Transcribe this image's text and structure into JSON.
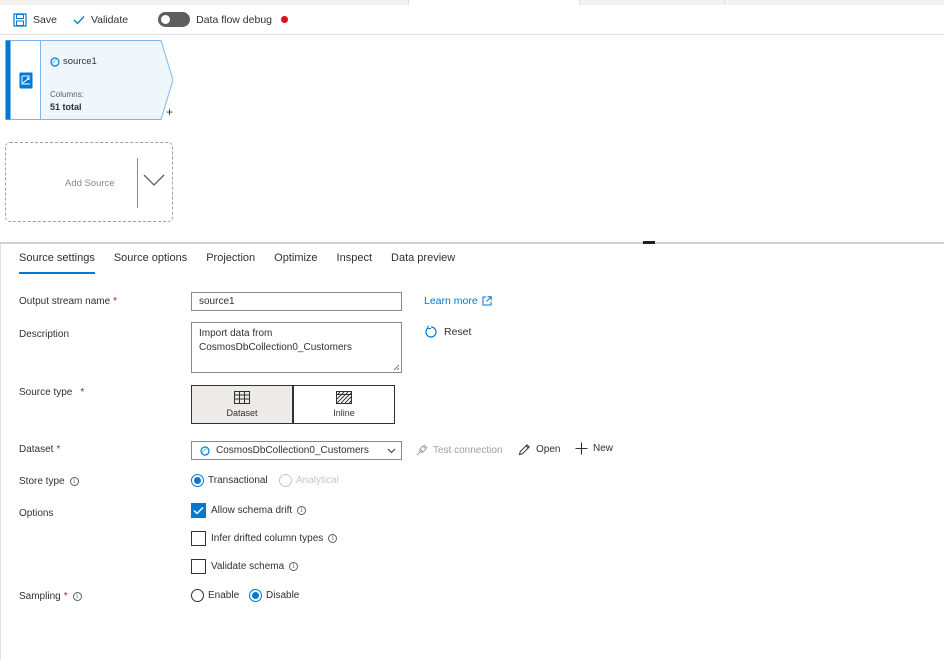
{
  "toolbar": {
    "save_label": "Save",
    "validate_label": "Validate",
    "debug_label": "Data flow debug",
    "debug_on": false
  },
  "canvas": {
    "node": {
      "name": "source1",
      "columns_label": "Columns:",
      "columns_value": "51 total",
      "plus": "+"
    },
    "add_source_label": "Add Source"
  },
  "tabs": [
    "Source settings",
    "Source options",
    "Projection",
    "Optimize",
    "Inspect",
    "Data preview"
  ],
  "active_tab": "Source settings",
  "form": {
    "output_stream": {
      "label": "Output stream name",
      "required": "*",
      "value": "source1",
      "learn_more": "Learn more"
    },
    "description": {
      "label": "Description",
      "line1": "Import data from",
      "line2": "CosmosDbCollection0_Customers",
      "reset": "Reset"
    },
    "source_type": {
      "label": "Source type",
      "required": "*",
      "options": [
        "Dataset",
        "Inline"
      ],
      "selected": "Dataset"
    },
    "dataset": {
      "label": "Dataset",
      "required": "*",
      "value": "CosmosDbCollection0_Customers",
      "test_connection": "Test connection",
      "open": "Open",
      "new": "New"
    },
    "store_type": {
      "label": "Store type",
      "options": [
        "Transactional",
        "Analytical"
      ],
      "selected": "Transactional"
    },
    "options": {
      "label": "Options",
      "items": [
        {
          "label": "Allow schema drift",
          "checked": true
        },
        {
          "label": "Infer drifted column types",
          "checked": false
        },
        {
          "label": "Validate schema",
          "checked": false
        }
      ]
    },
    "sampling": {
      "label": "Sampling",
      "required": "*",
      "options": [
        "Enable",
        "Disable"
      ],
      "selected": "Disable"
    }
  },
  "colors": {
    "accent": "#0078d4",
    "debug_dot": "#e00b1c",
    "required": "#a4262c"
  }
}
